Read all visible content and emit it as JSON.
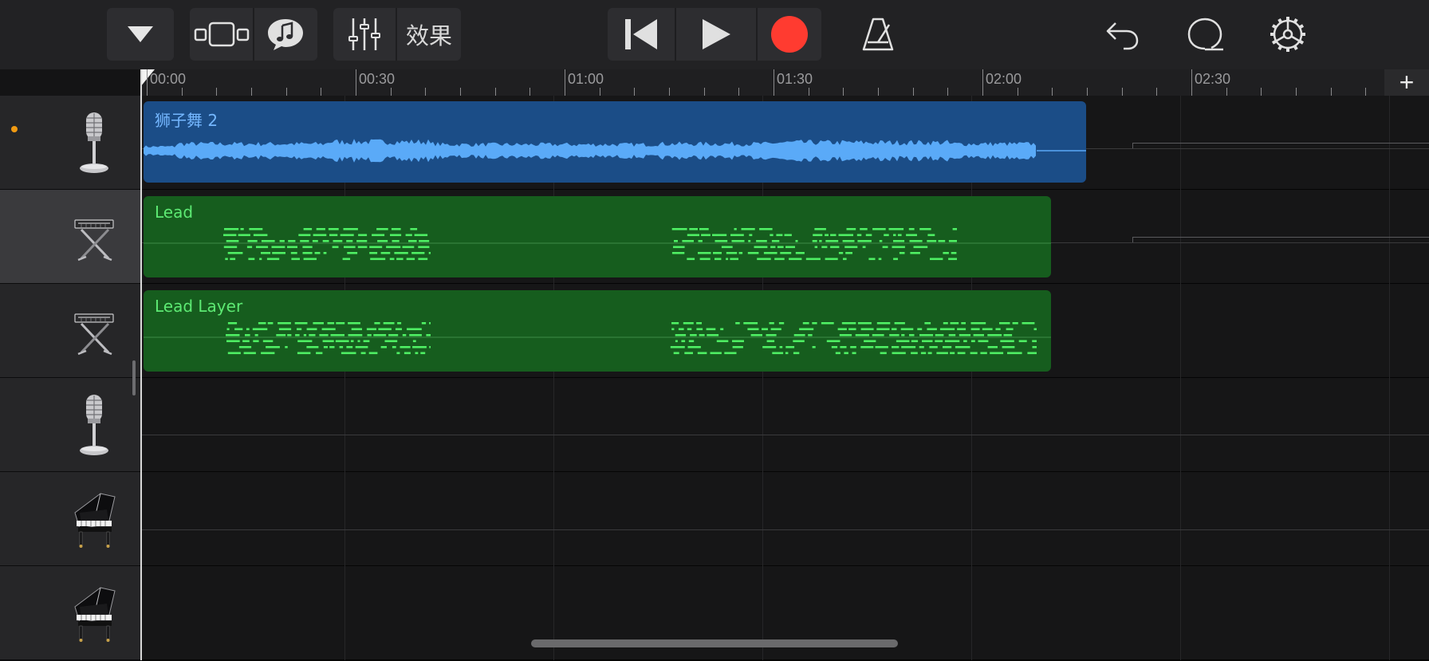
{
  "toolbar": {
    "browser_button": "chevron-down-icon",
    "tracks_view": "tracks-view-icon",
    "loops": "loop-browser-icon",
    "mixer": "mixer-icon",
    "fx_label": "效果",
    "rewind": "skip-back-icon",
    "play": "play-icon",
    "record": "record-icon",
    "metronome": "metronome-icon",
    "undo": "undo-icon",
    "loop_toggle": "loop-circle-icon",
    "settings": "gear-icon",
    "record_color": "#ff3b30"
  },
  "ruler": {
    "labels": [
      "00:00",
      "00:30",
      "01:00",
      "01:30",
      "02:00",
      "02:30"
    ],
    "add_button": "+"
  },
  "tracks": [
    {
      "instrument": "microphone-icon",
      "armed": true,
      "selected": false
    },
    {
      "instrument": "keyboard-stand-icon",
      "armed": false,
      "selected": true
    },
    {
      "instrument": "keyboard-stand-icon",
      "armed": false,
      "selected": false
    },
    {
      "instrument": "microphone-icon",
      "armed": false,
      "selected": false
    },
    {
      "instrument": "grand-piano-icon",
      "armed": false,
      "selected": false
    },
    {
      "instrument": "grand-piano-icon",
      "armed": false,
      "selected": false
    }
  ],
  "regions": [
    {
      "type": "audio",
      "title": "狮子舞 2",
      "track": 0,
      "color": "#1b4d87"
    },
    {
      "type": "midi",
      "title": "Lead",
      "track": 1,
      "color": "#165d1e"
    },
    {
      "type": "midi",
      "title": "Lead Layer",
      "track": 2,
      "color": "#165d1e"
    }
  ]
}
